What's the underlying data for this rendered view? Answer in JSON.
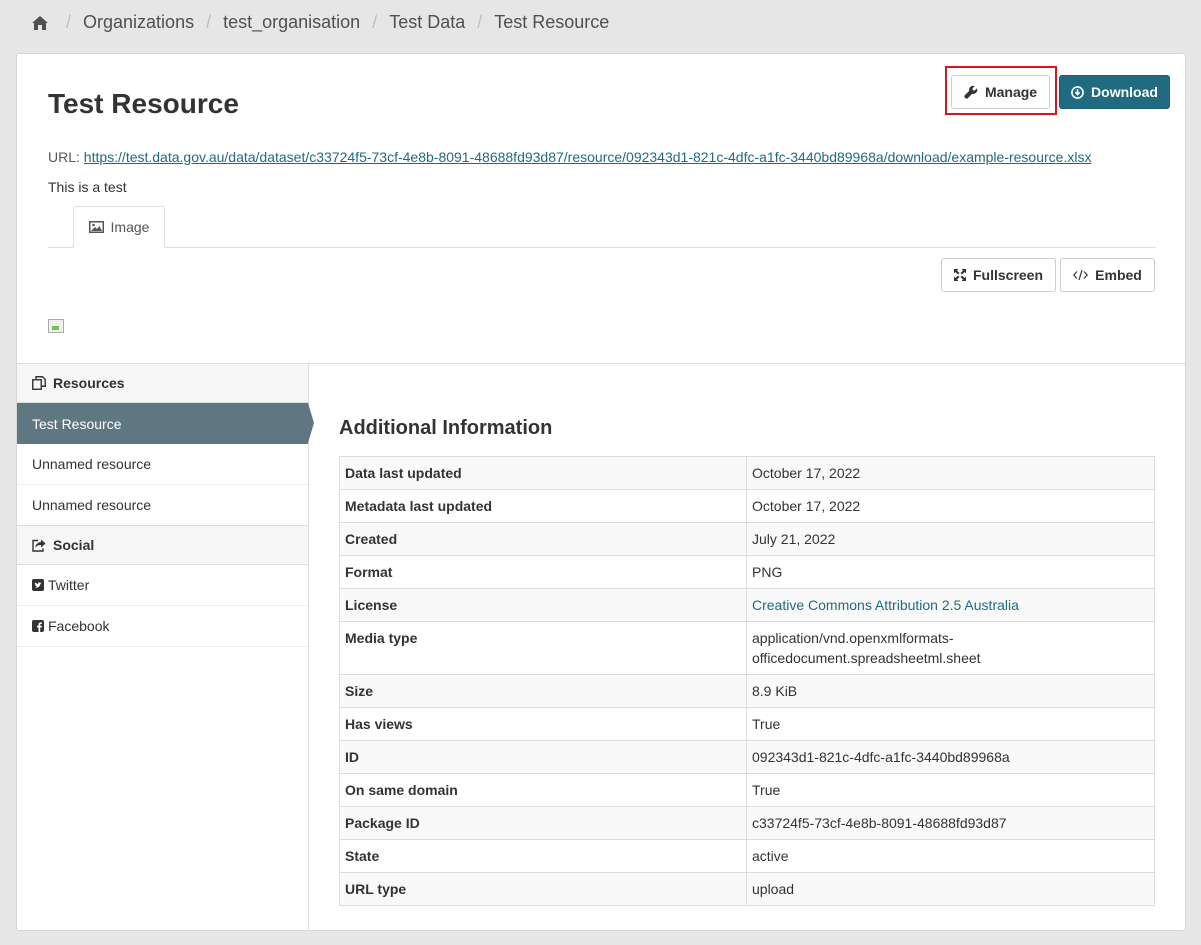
{
  "breadcrumb": {
    "home_icon": "home-icon",
    "items": [
      "Organizations",
      "test_organisation",
      "Test Data",
      "Test Resource"
    ]
  },
  "resource": {
    "title": "Test Resource",
    "url_label": "URL:",
    "url": "https://test.data.gov.au/data/dataset/c33724f5-73cf-4e8b-8091-48688fd93d87/resource/092343d1-821c-4dfc-a1fc-3440bd89968a/download/example-resource.xlsx",
    "description": "This is a test"
  },
  "actions": {
    "manage_label": "Manage",
    "download_label": "Download",
    "fullscreen_label": "Fullscreen",
    "embed_label": "Embed"
  },
  "view_tabs": [
    {
      "label": "Image",
      "icon": "image-icon"
    }
  ],
  "sidebar": {
    "resources_heading": "Resources",
    "resources": [
      "Test Resource",
      "Unnamed resource",
      "Unnamed resource"
    ],
    "social_heading": "Social",
    "social": [
      {
        "label": "Twitter",
        "icon": "twitter-icon"
      },
      {
        "label": "Facebook",
        "icon": "facebook-icon"
      }
    ]
  },
  "additional_info": {
    "title": "Additional Information",
    "rows": [
      {
        "key": "Data last updated",
        "value": "October 17, 2022"
      },
      {
        "key": "Metadata last updated",
        "value": "October 17, 2022"
      },
      {
        "key": "Created",
        "value": "July 21, 2022"
      },
      {
        "key": "Format",
        "value": "PNG"
      },
      {
        "key": "License",
        "value": "Creative Commons Attribution 2.5 Australia"
      },
      {
        "key": "Media type",
        "value": "application/vnd.openxmlformats-officedocument.spreadsheetml.sheet"
      },
      {
        "key": "Size",
        "value": "8.9 KiB"
      },
      {
        "key": "Has views",
        "value": "True"
      },
      {
        "key": "ID",
        "value": "092343d1-821c-4dfc-a1fc-3440bd89968a"
      },
      {
        "key": "On same domain",
        "value": "True"
      },
      {
        "key": "Package ID",
        "value": "c33724f5-73cf-4e8b-8091-48688fd93d87"
      },
      {
        "key": "State",
        "value": "active"
      },
      {
        "key": "URL type",
        "value": "upload"
      }
    ]
  },
  "colors": {
    "primary": "#206b82",
    "sidebar_active": "#5f7780",
    "highlight": "#d9141b"
  }
}
